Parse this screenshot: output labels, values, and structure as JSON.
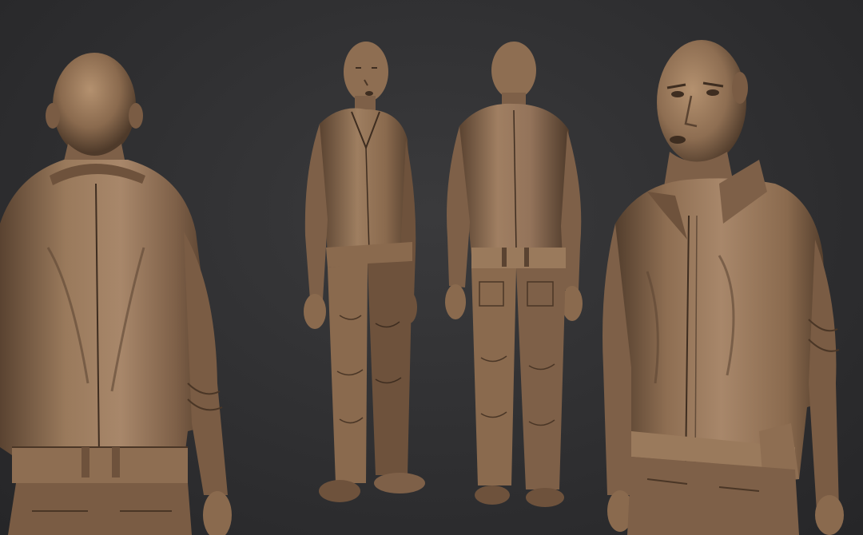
{
  "scene": {
    "background_color": "#2f2f31",
    "material_color": "#8a6a4e",
    "material_highlight": "#b08e6e",
    "material_shadow": "#4a3626"
  },
  "views": [
    {
      "id": "back-closeup",
      "icon": "sculpt-back-closeup"
    },
    {
      "id": "front-three-quarter-full",
      "icon": "sculpt-front-full"
    },
    {
      "id": "back-full",
      "icon": "sculpt-back-full"
    },
    {
      "id": "front-closeup",
      "icon": "sculpt-front-closeup"
    }
  ]
}
